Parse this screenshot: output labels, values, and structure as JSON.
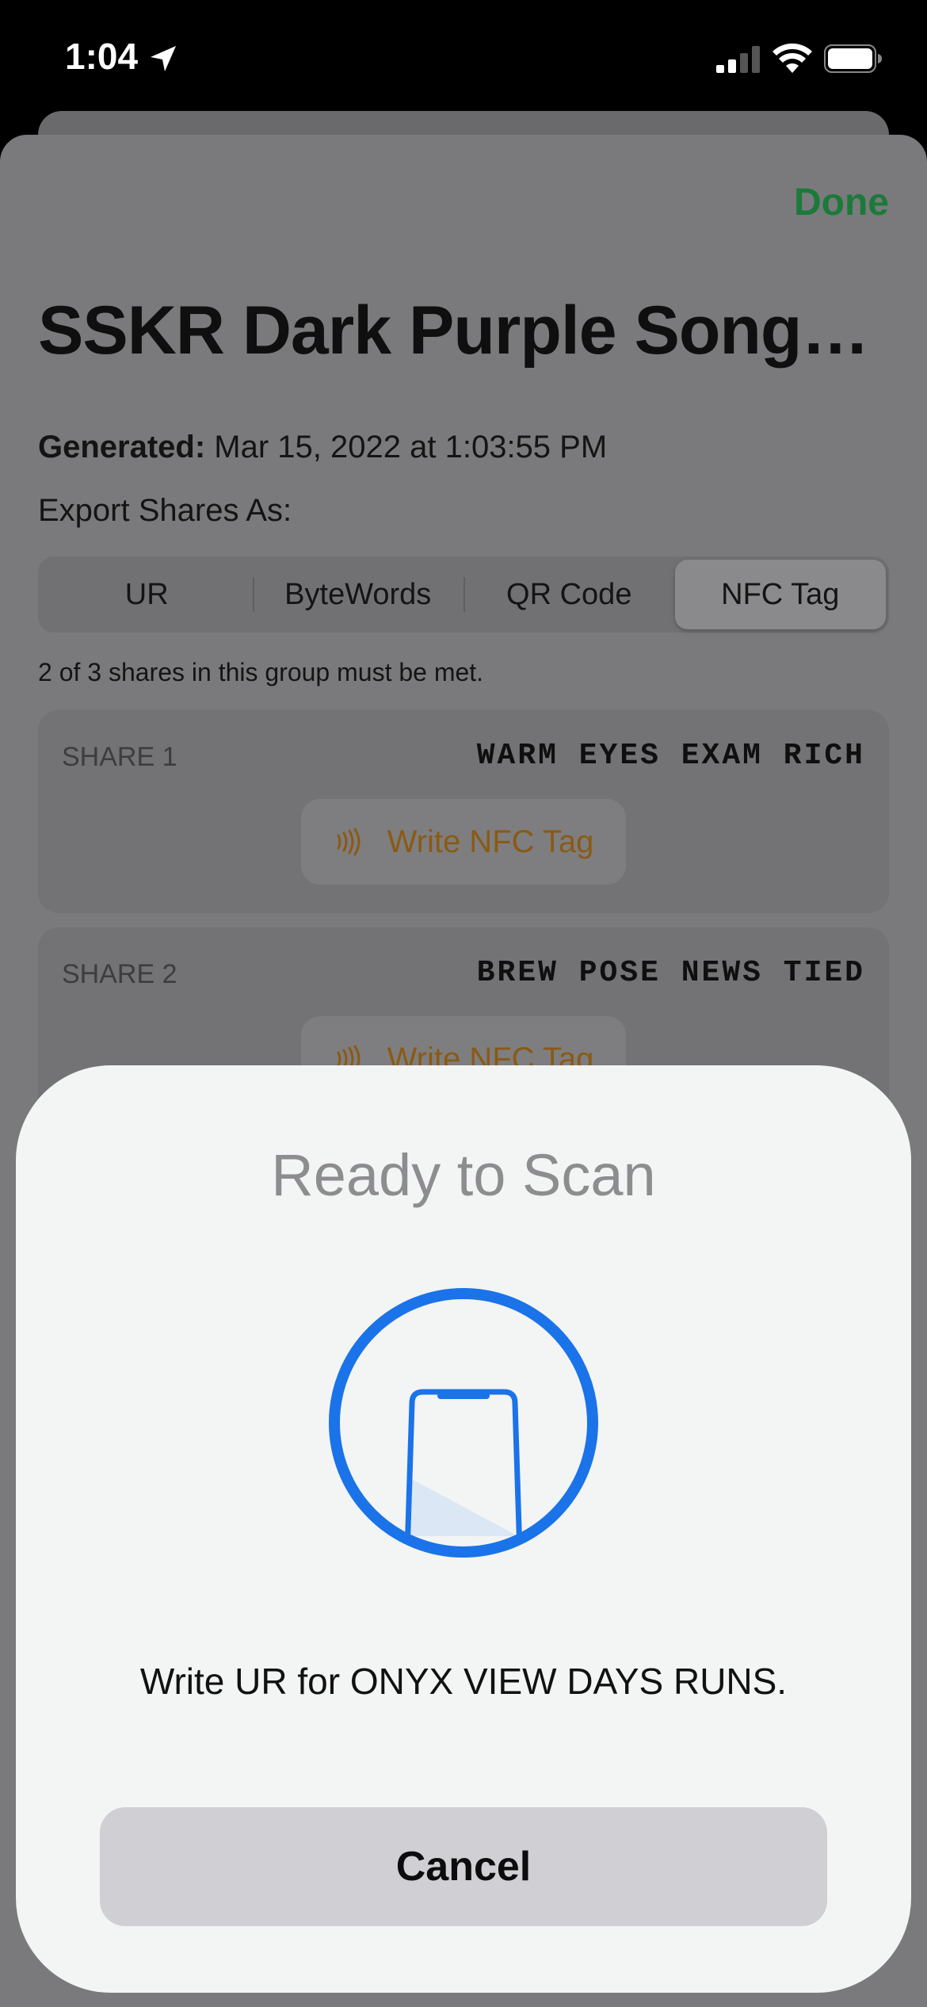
{
  "status_bar": {
    "time": "1:04"
  },
  "sheet": {
    "done_label": "Done",
    "title": "SSKR Dark Purple Song…",
    "generated_label": "Generated:",
    "generated_value": "Mar 15, 2022 at 1:03:55 PM",
    "export_label": "Export Shares As:",
    "segments": [
      {
        "label": "UR"
      },
      {
        "label": "ByteWords"
      },
      {
        "label": "QR Code"
      },
      {
        "label": "NFC Tag"
      }
    ],
    "selected_segment": "NFC Tag",
    "threshold_text": "2 of 3 shares in this group must be met.",
    "shares": [
      {
        "label": "SHARE 1",
        "words": "WARM EYES EXAM RICH",
        "button": "Write NFC Tag"
      },
      {
        "label": "SHARE 2",
        "words": "BREW POSE NEWS TIED",
        "button": "Write NFC Tag"
      }
    ]
  },
  "nfc_modal": {
    "title": "Ready to Scan",
    "icon": "phone-scan-icon",
    "message": "Write UR for ONYX VIEW DAYS RUNS.",
    "cancel_label": "Cancel"
  },
  "colors": {
    "accent_blue": "#1a73e8",
    "done_green": "#1b7a3a",
    "nfc_orange": "#8a5a14"
  }
}
